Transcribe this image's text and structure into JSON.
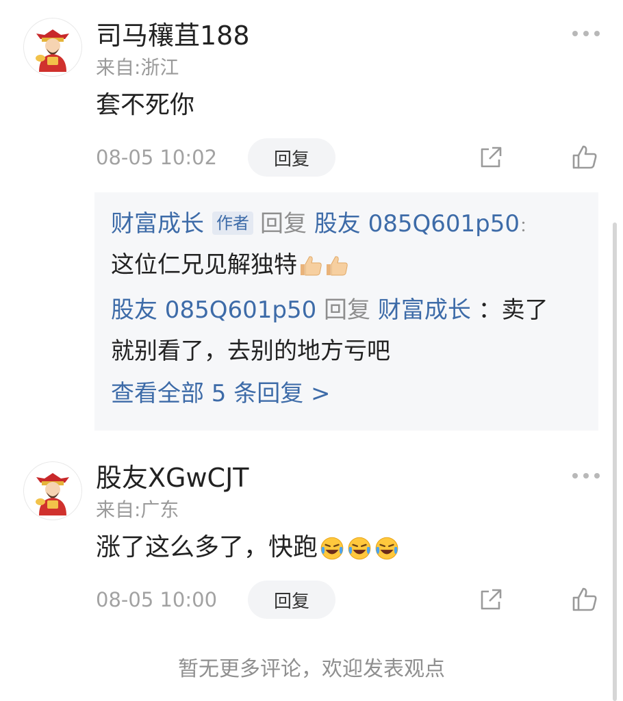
{
  "comments": [
    {
      "username": "司马穰苴188",
      "location": "来自:浙江",
      "text": "套不死你",
      "time": "08-05 10:02",
      "reply_label": "回复",
      "avatar_icon": "fortune-god-avatar-icon",
      "share_icon": "share-icon",
      "like_icon": "thumbs-up-icon",
      "more_icon": "more-dots-icon"
    },
    {
      "username": "股友XGwCJT",
      "location": "来自:广东",
      "text": "涨了这么多了，快跑",
      "emoji": "laughing-crying-emoji x3",
      "time": "08-05 10:00",
      "reply_label": "回复",
      "avatar_icon": "fortune-god-avatar-icon",
      "share_icon": "share-icon",
      "like_icon": "thumbs-up-icon",
      "more_icon": "more-dots-icon"
    }
  ],
  "replies": [
    {
      "from": "财富成长",
      "author_tag": "作者",
      "action": "回复",
      "to": "股友 085Q601p50",
      "separator": "：",
      "text": "这位仁兄见解独特",
      "emoji": "thumbs-up-emoji x2"
    },
    {
      "from": "股友 085Q601p50",
      "action": "回复",
      "to": "财富成长",
      "separator": "：",
      "text_line1": "卖了",
      "text_line2": "就别看了，去别的地方亏吧"
    }
  ],
  "view_all_replies": "查看全部 5 条回复 >",
  "footer": "暂无更多评论，欢迎发表观点",
  "colors": {
    "link_blue": "#3d6ba8",
    "muted": "#9a9a9a",
    "reply_bg": "#f6f7f9"
  }
}
